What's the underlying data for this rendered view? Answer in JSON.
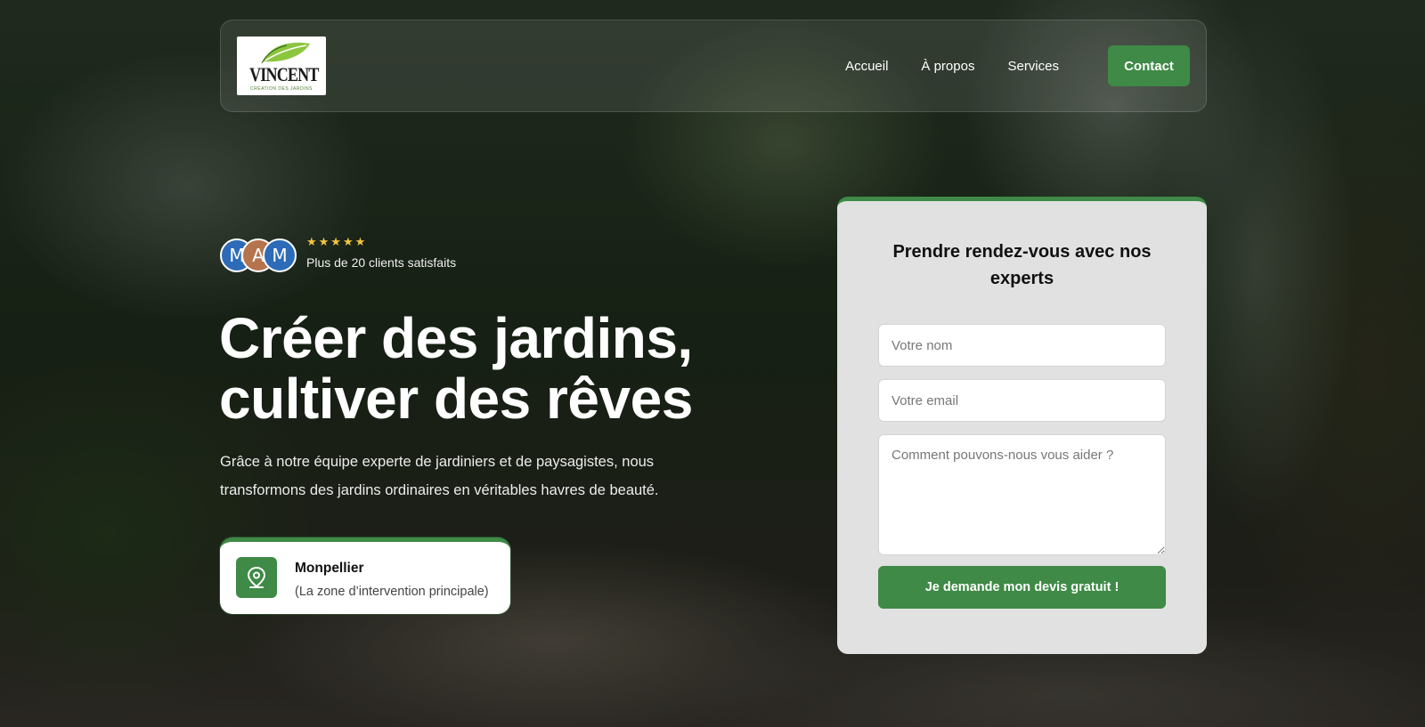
{
  "brand": {
    "logo_word": "VINCENT",
    "logo_sub": "CRÉATION DES JARDINS"
  },
  "nav": {
    "items": [
      {
        "label": "Accueil"
      },
      {
        "label": "À propos"
      },
      {
        "label": "Services"
      }
    ],
    "contact_label": "Contact"
  },
  "testimonial": {
    "avatars": [
      {
        "initial": "M",
        "color": "#2d6bb8"
      },
      {
        "initial": "A",
        "color": "#b5734e"
      },
      {
        "initial": "M",
        "color": "#2d6bb8"
      }
    ],
    "stars": "★★★★★",
    "rating": 5,
    "text": "Plus de 20 clients satisfaits"
  },
  "hero": {
    "title_line1": "Créer des jardins,",
    "title_line2": "cultiver des rêves",
    "description": "Grâce à notre équipe experte de jardiniers et de paysagistes, nous transformons des jardins ordinaires en véritables havres de beauté."
  },
  "location": {
    "icon": "map-pin-icon",
    "city": "Monpellier",
    "subtitle": "(La zone d’intervention principale)"
  },
  "form": {
    "title": "Prendre rendez-vous avec nos experts",
    "name_placeholder": "Votre nom",
    "email_placeholder": "Votre email",
    "message_placeholder": "Comment pouvons-nous vous aider ?",
    "submit_label": "Je demande mon devis gratuit !"
  },
  "colors": {
    "accent": "#3e8a46",
    "star": "#f5c542",
    "card_bg": "#e1e1e1"
  }
}
